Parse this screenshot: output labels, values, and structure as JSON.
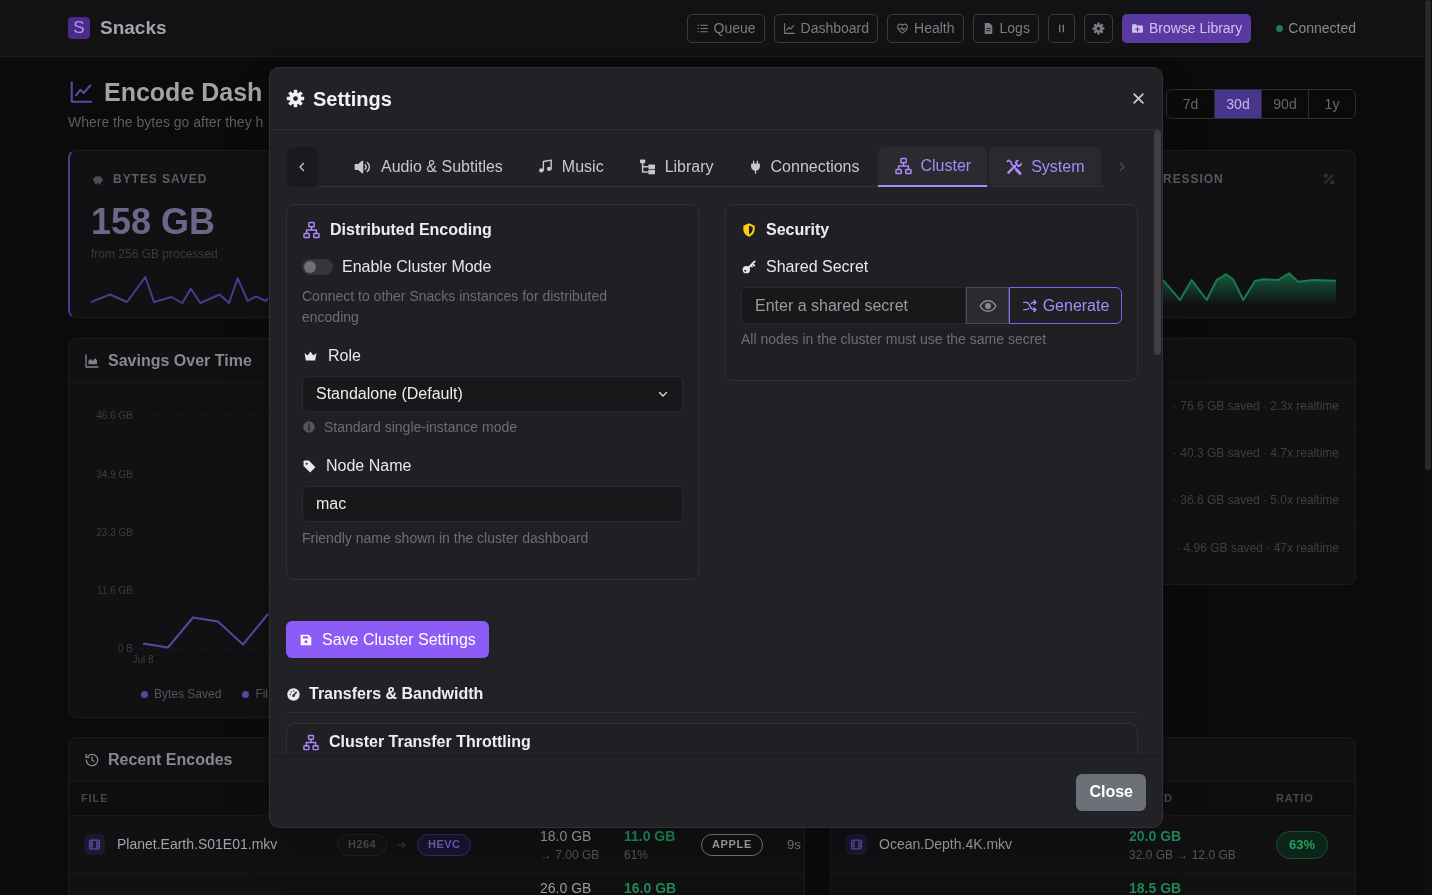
{
  "top_bar": {
    "logo_letter": "S",
    "app_name": "Snacks",
    "nav_buttons": [
      {
        "label": "Queue"
      },
      {
        "label": "Dashboard"
      },
      {
        "label": "Health"
      },
      {
        "label": "Logs"
      }
    ],
    "library_button": "Browse Library",
    "connection": {
      "label": "Connected",
      "online": true
    }
  },
  "dashboard": {
    "title": "Encode Dash",
    "subtitle": "Where the bytes go after they h",
    "ranges": [
      {
        "label": "7d",
        "selected": false
      },
      {
        "label": "30d",
        "selected": true
      },
      {
        "label": "90d",
        "selected": false
      },
      {
        "label": "1y",
        "selected": false
      }
    ]
  },
  "bytes_saved_card": {
    "label": "BYTES SAVED",
    "value": "158 GB",
    "caption": "from 256 GB processed"
  },
  "stat_card_2": {
    "label": "RESSION"
  },
  "savings_chart": {
    "title": "Savings Over Time",
    "chart_data": {
      "type": "line",
      "values": [
        1.0,
        0.2,
        6.2,
        5.4,
        0.8,
        6.9
      ],
      "ylim": [
        0,
        46.6
      ],
      "yticks": [
        {
          "value": 0,
          "label": "0 B"
        },
        {
          "value": 11.6,
          "label": "11.6 GB"
        },
        {
          "value": 23.3,
          "label": "23.3 GB"
        },
        {
          "value": 34.9,
          "label": "34.9 GB"
        },
        {
          "value": 46.6,
          "label": "46.6 GB"
        }
      ]
    },
    "x_axis_start_label": "Jul 8",
    "legend": [
      {
        "label": "Bytes Saved"
      },
      {
        "label": "Fil"
      }
    ]
  },
  "activity_list": {
    "items": [
      "· 76.6 GB saved · 2.3x realtime",
      "· 40.3 GB saved · 4.7x realtime",
      "· 36.6 GB saved · 5.0x realtime",
      "· 4.96 GB saved · 47x realtime"
    ]
  },
  "recent_encodes": {
    "title": "Recent Encodes",
    "columns": [
      "FILE"
    ],
    "rows": [
      {
        "file": "Planet.Earth.S01E01.mkv",
        "source_codec": "H264",
        "target_codec": "HEVC",
        "original_size": "18.0 GB",
        "new_size": "→ 7.00 GB",
        "saved": "11.0 GB",
        "saved_percent": "61%",
        "encoder": "APPLE",
        "duration": "9s"
      },
      {
        "original_size": "26.0 GB",
        "saved": "16.0 GB"
      }
    ]
  },
  "encodes_table_2": {
    "columns": [
      "D",
      "RATIO"
    ],
    "rows": [
      {
        "file": "Ocean.Depth.4K.mkv",
        "saved": "20.0 GB",
        "sizes": "32.0 GB → 12.0 GB",
        "ratio": "63%"
      },
      {
        "saved": "18.5 GB"
      }
    ]
  },
  "settings_dialog": {
    "title": "Settings",
    "tabs": [
      {
        "label": "Audio & Subtitles",
        "selected": false,
        "hovered": false
      },
      {
        "label": "Music",
        "selected": false,
        "hovered": false
      },
      {
        "label": "Library",
        "selected": false,
        "hovered": false
      },
      {
        "label": "Connections",
        "selected": false,
        "hovered": false
      },
      {
        "label": "Cluster",
        "selected": true,
        "hovered": false
      },
      {
        "label": "System",
        "selected": false,
        "hovered": true
      }
    ],
    "distributed_encoding": {
      "title": "Distributed Encoding",
      "cluster_mode": {
        "label": "Enable Cluster Mode",
        "on": false
      },
      "description": "Connect to other Snacks instances for distributed encoding",
      "role": {
        "label": "Role",
        "value": "Standalone (Default)",
        "hint": "Standard single-instance mode"
      },
      "node_name": {
        "label": "Node Name",
        "value": "mac",
        "hint": "Friendly name shown in the cluster dashboard"
      }
    },
    "security": {
      "title": "Security",
      "shared_secret": {
        "label": "Shared Secret",
        "placeholder": "Enter a shared secret",
        "generate_button": "Generate",
        "hint": "All nodes in the cluster must use the same secret"
      }
    },
    "save_button": "Save Cluster Settings",
    "transfers": {
      "title": "Transfers & Bandwidth",
      "panel_title": "Cluster Transfer Throttling"
    },
    "close_button": "Close"
  }
}
